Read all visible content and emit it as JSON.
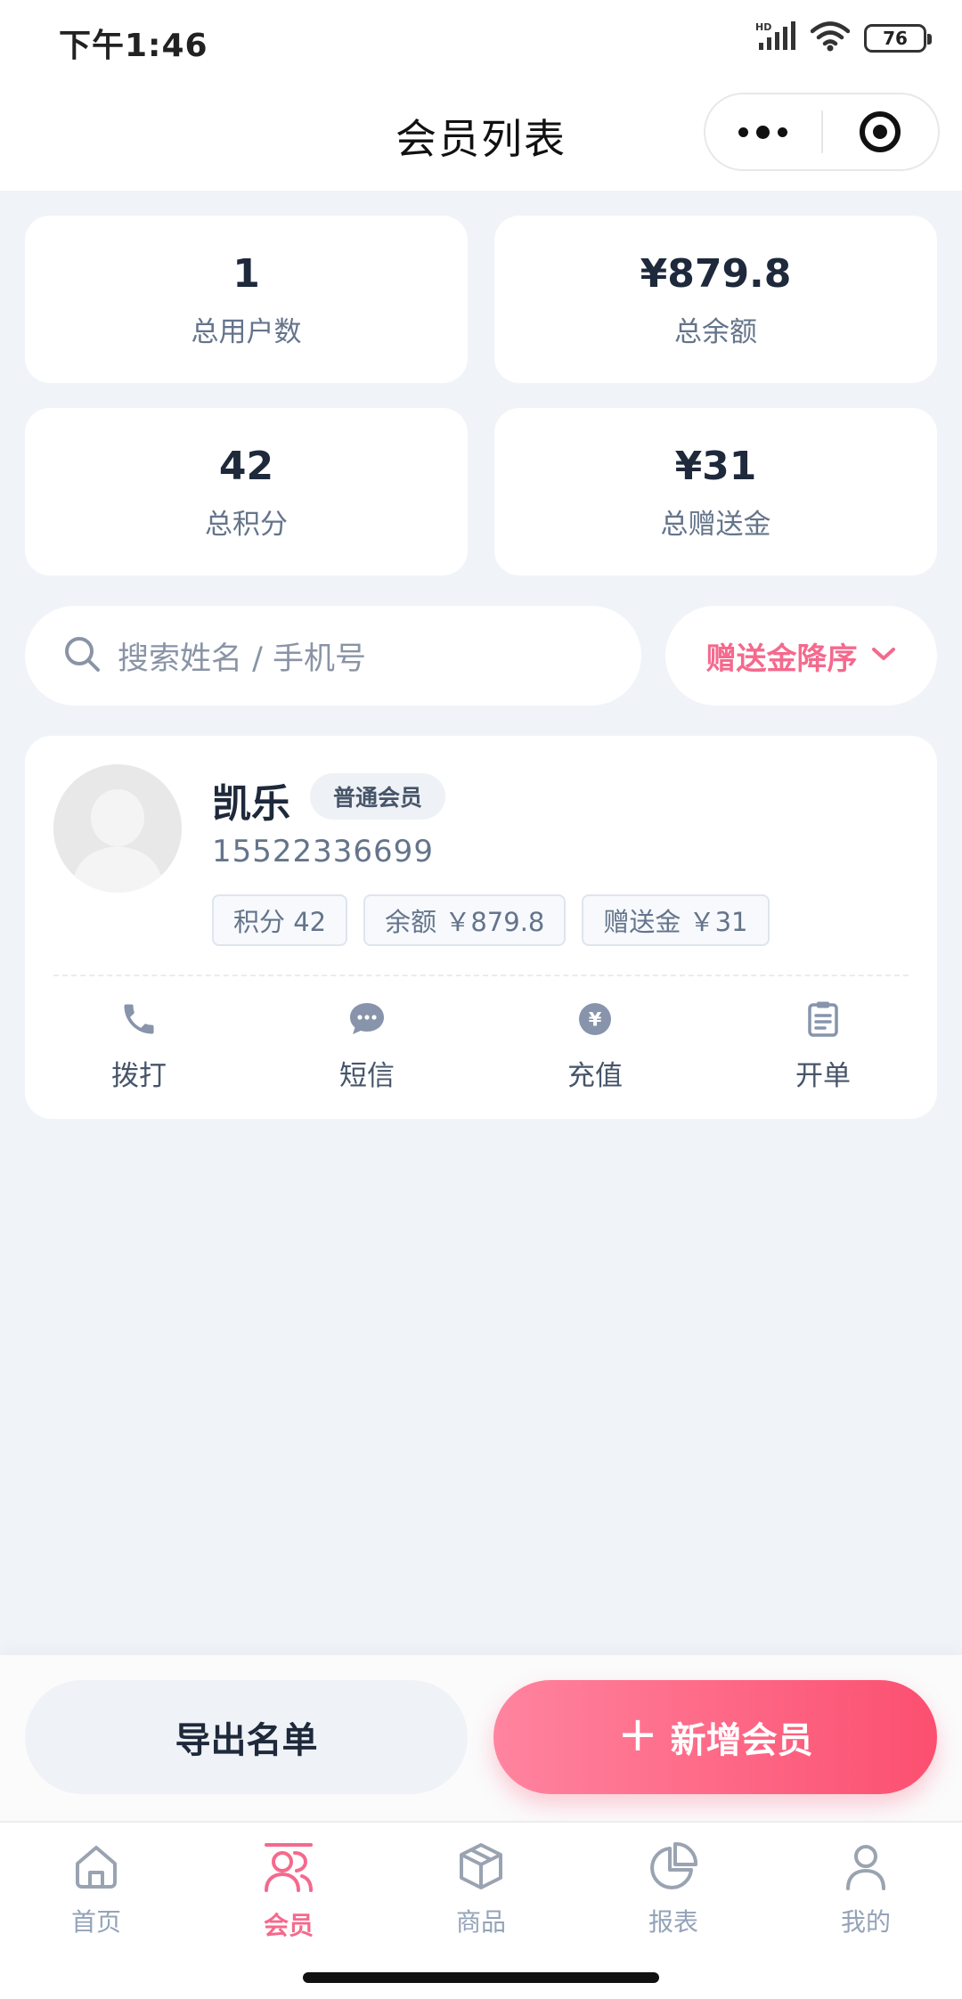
{
  "status_bar": {
    "time": "下午1:46",
    "network": "HD",
    "battery": "76"
  },
  "header": {
    "title": "会员列表"
  },
  "stats": [
    {
      "value": "1",
      "label": "总用户数"
    },
    {
      "value": "¥879.8",
      "label": "总余额"
    },
    {
      "value": "42",
      "label": "总积分"
    },
    {
      "value": "¥31",
      "label": "总赠送金"
    }
  ],
  "search": {
    "placeholder": "搜索姓名 / 手机号"
  },
  "sort": {
    "label": "赠送金降序"
  },
  "member": {
    "name": "凯乐",
    "level": "普通会员",
    "phone": "15522336699",
    "chips": [
      "积分 42",
      "余额 ￥879.8",
      "赠送金 ￥31"
    ],
    "actions": [
      "拨打",
      "短信",
      "充值",
      "开单"
    ]
  },
  "buttons": {
    "export": "导出名单",
    "add": "新增会员",
    "add_icon": "+"
  },
  "tabs": [
    {
      "label": "首页",
      "icon": "home-icon"
    },
    {
      "label": "会员",
      "icon": "members-icon",
      "active": true
    },
    {
      "label": "商品",
      "icon": "box-icon"
    },
    {
      "label": "报表",
      "icon": "pie-chart-icon"
    },
    {
      "label": "我的",
      "icon": "user-icon"
    }
  ],
  "colors": {
    "accent": "#f5698d",
    "background": "#f0f3f8",
    "primary_gradient": [
      "#ff849f",
      "#fc4f70"
    ]
  }
}
